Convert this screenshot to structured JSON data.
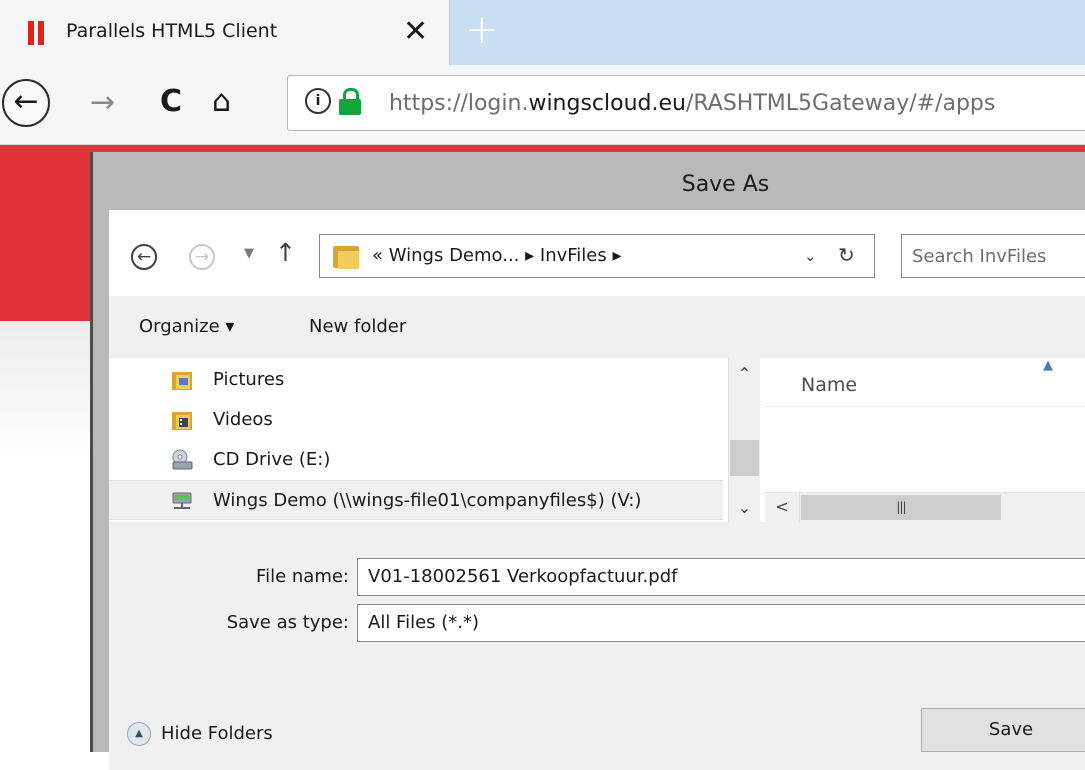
{
  "browser": {
    "tab_title": "Parallels HTML5 Client",
    "tab_close": "✕",
    "new_tab": "+",
    "url_prefix": "https://login.",
    "url_domain": "wingscloud.eu",
    "url_path": "/RASHTML5Gateway/#/apps"
  },
  "dialog": {
    "title": "Save As",
    "breadcrumb": "« Wings Demo... ▸ InvFiles ▸",
    "search_placeholder": "Search InvFiles",
    "toolbar": {
      "organize": "Organize ▾",
      "new_folder": "New folder"
    },
    "nav_items": [
      {
        "label": "Pictures",
        "icon": "pictures-folder-icon"
      },
      {
        "label": "Videos",
        "icon": "videos-folder-icon"
      },
      {
        "label": "CD Drive (E:)",
        "icon": "cd-drive-icon"
      },
      {
        "label": "Wings Demo (\\\\wings-file01\\companyfiles$) (V:)",
        "icon": "network-drive-icon",
        "selected": true
      }
    ],
    "column_name": "Name",
    "file_name_label": "File name:",
    "file_name_value": "V01-18002561 Verkoopfactuur.pdf",
    "save_type_label": "Save as type:",
    "save_type_value": "All Files (*.*)",
    "hide_folders": "Hide Folders",
    "save_button": "Save"
  },
  "colors": {
    "brand_red": "#e2323c",
    "secure_green": "#12a53c"
  }
}
